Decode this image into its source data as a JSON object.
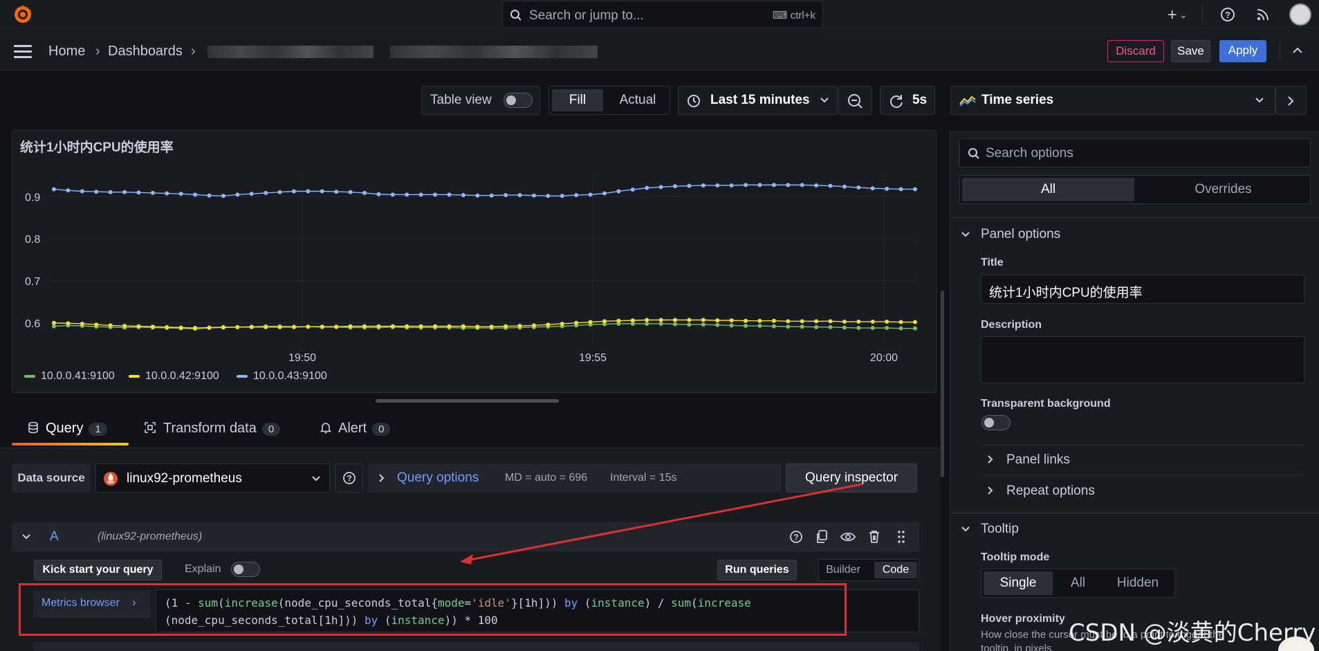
{
  "topbar": {
    "search_placeholder": "Search or jump to...",
    "search_shortcut": "ctrl+k",
    "icons": [
      "grafana-logo",
      "search-icon",
      "keyboard-icon",
      "plus-icon",
      "help-icon",
      "rss-icon",
      "avatar"
    ]
  },
  "breadcrumb": {
    "items": [
      "Home",
      "Dashboards"
    ],
    "separator": "›"
  },
  "actions": {
    "discard": "Discard",
    "save": "Save",
    "apply": "Apply"
  },
  "toolbar": {
    "table_view": "Table view",
    "fill": "Fill",
    "actual": "Actual",
    "time_range": "Last 15 minutes",
    "refresh": "5s",
    "viz_type": "Time series"
  },
  "panel": {
    "title": "统计1小时内CPU的使用率"
  },
  "chart_data": {
    "type": "line",
    "title": "统计1小时内CPU的使用率",
    "ylim": [
      0.57,
      0.95
    ],
    "yticks": [
      "0.9",
      "0.8",
      "0.7",
      "0.6"
    ],
    "xticks": [
      "19:50",
      "19:55",
      "20:00"
    ],
    "grid": true,
    "legend_position": "bottom-left",
    "series": [
      {
        "name": "10.0.0.41:9100",
        "color": "#73bf69",
        "values": [
          0.592,
          0.594,
          0.593,
          0.591,
          0.59,
          0.589,
          0.59,
          0.589,
          0.588,
          0.587,
          0.586,
          0.588,
          0.589,
          0.59,
          0.591,
          0.592,
          0.592,
          0.591,
          0.591,
          0.59,
          0.59,
          0.589,
          0.589,
          0.589,
          0.59,
          0.589,
          0.589,
          0.589,
          0.589,
          0.588,
          0.588,
          0.588,
          0.588,
          0.589,
          0.59,
          0.591,
          0.592,
          0.594,
          0.596,
          0.597,
          0.598,
          0.598,
          0.598,
          0.598,
          0.597,
          0.596,
          0.596,
          0.595,
          0.594,
          0.593,
          0.593,
          0.592,
          0.591,
          0.591,
          0.59,
          0.59,
          0.589,
          0.588,
          0.588,
          0.588,
          0.587,
          0.587
        ]
      },
      {
        "name": "10.0.0.42:9100",
        "color": "#fade2a",
        "values": [
          0.6,
          0.599,
          0.598,
          0.596,
          0.594,
          0.593,
          0.592,
          0.591,
          0.59,
          0.589,
          0.588,
          0.589,
          0.59,
          0.59,
          0.59,
          0.59,
          0.59,
          0.59,
          0.591,
          0.591,
          0.591,
          0.592,
          0.592,
          0.592,
          0.592,
          0.592,
          0.592,
          0.592,
          0.592,
          0.592,
          0.591,
          0.591,
          0.592,
          0.593,
          0.594,
          0.596,
          0.598,
          0.6,
          0.602,
          0.604,
          0.605,
          0.606,
          0.607,
          0.607,
          0.607,
          0.607,
          0.607,
          0.606,
          0.606,
          0.605,
          0.605,
          0.605,
          0.604,
          0.604,
          0.604,
          0.604,
          0.603,
          0.603,
          0.603,
          0.603,
          0.602,
          0.602
        ]
      },
      {
        "name": "10.0.0.43:9100",
        "color": "#8ab8ff",
        "values": [
          0.918,
          0.915,
          0.913,
          0.912,
          0.911,
          0.911,
          0.91,
          0.909,
          0.908,
          0.907,
          0.905,
          0.903,
          0.902,
          0.905,
          0.907,
          0.909,
          0.911,
          0.913,
          0.913,
          0.913,
          0.912,
          0.911,
          0.909,
          0.906,
          0.905,
          0.905,
          0.905,
          0.905,
          0.905,
          0.904,
          0.903,
          0.903,
          0.904,
          0.904,
          0.903,
          0.902,
          0.902,
          0.904,
          0.905,
          0.908,
          0.913,
          0.917,
          0.921,
          0.923,
          0.925,
          0.926,
          0.927,
          0.927,
          0.927,
          0.928,
          0.928,
          0.928,
          0.928,
          0.928,
          0.927,
          0.926,
          0.924,
          0.922,
          0.92,
          0.919,
          0.918,
          0.918
        ]
      }
    ]
  },
  "tabs": [
    {
      "label": "Query",
      "count": "1"
    },
    {
      "label": "Transform data",
      "count": "0"
    },
    {
      "label": "Alert",
      "count": "0"
    }
  ],
  "query": {
    "datasource_label": "Data source",
    "datasource": "linux92-prometheus",
    "query_options": "Query options",
    "md": "MD = auto = 696",
    "interval": "Interval = 15s",
    "inspector": "Query inspector",
    "refid": "A",
    "refds": "(linux92-prometheus)",
    "kickstart": "Kick start your query",
    "explain": "Explain",
    "run": "Run queries",
    "builder": "Builder",
    "code": "Code",
    "metrics_browser": "Metrics browser",
    "expr_line1_a": "(1 - ",
    "expr_sum": "sum",
    "expr_paren": "(",
    "expr_increase": "increase",
    "expr_line1_b": "(node_cpu_seconds_total{",
    "expr_mode": "mode",
    "expr_eq": "=",
    "expr_idle": "'idle'",
    "expr_line1_c": "}[1h])) ",
    "expr_by": "by",
    "expr_line1_d": " (",
    "expr_instance": "instance",
    "expr_line1_e": ") / ",
    "expr_line2_a": "(node_cpu_seconds_total[1h])) ",
    "expr_line2_b": ")) * 100"
  },
  "options": {
    "search_placeholder": "Search options",
    "tab_all": "All",
    "tab_overrides": "Overrides",
    "panel_options": "Panel options",
    "title_label": "Title",
    "title_value": "统计1小时内CPU的使用率",
    "description_label": "Description",
    "transparent_label": "Transparent background",
    "panel_links": "Panel links",
    "repeat_options": "Repeat options",
    "tooltip": "Tooltip",
    "tooltip_mode": "Tooltip mode",
    "mode_single": "Single",
    "mode_all": "All",
    "mode_hidden": "Hidden",
    "hover_proximity": "Hover proximity",
    "hover_desc_1": "How close the cursor must be to a point to trigger the",
    "hover_desc_2": "tooltip, in pixels"
  },
  "watermark": "CSDN @淡黄的Cherry"
}
